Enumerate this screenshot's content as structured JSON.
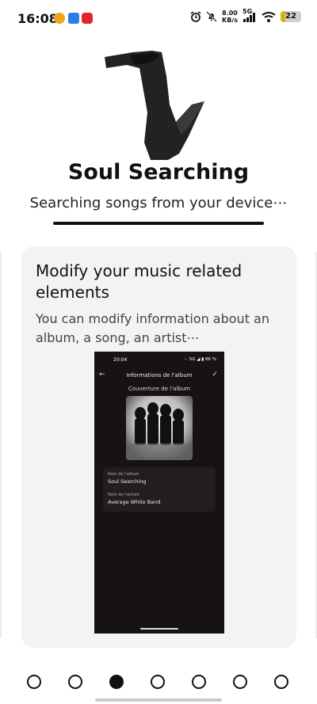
{
  "status_bar": {
    "time": "16:08",
    "net_speed_value": "8.00",
    "net_speed_unit": "KB/s",
    "network_type": "5G",
    "battery_level": "22",
    "icons": [
      "app-notification-icon",
      "chat-notification-icon",
      "music-notification-icon",
      "alarm-icon",
      "mute-icon",
      "signal-icon",
      "wifi-icon",
      "battery-icon"
    ]
  },
  "header": {
    "app_name": "Soul Searching",
    "status_text": "Searching songs from your device⋯",
    "progress_fraction": 1.0
  },
  "onboarding_card": {
    "title": "Modify your music related elements",
    "description": "You can modify information about an album, a song, an artist⋯",
    "preview": {
      "time": "20:04",
      "status": "⁘ 5G ◢ ▮ 86 %",
      "screen_title": "Informations de l'album",
      "cover_label": "Couverture de l'album",
      "album_name_label": "Nom de l'album",
      "album_name_value": "Soul Searching",
      "artist_name_label": "Nom de l'artiste",
      "artist_name_value": "Average White Band"
    }
  },
  "pager": {
    "total_pages": 7,
    "current_page": 3
  },
  "colors": {
    "accent": "#111111",
    "card_background": "#f3f3f3",
    "preview_background": "#171312"
  }
}
